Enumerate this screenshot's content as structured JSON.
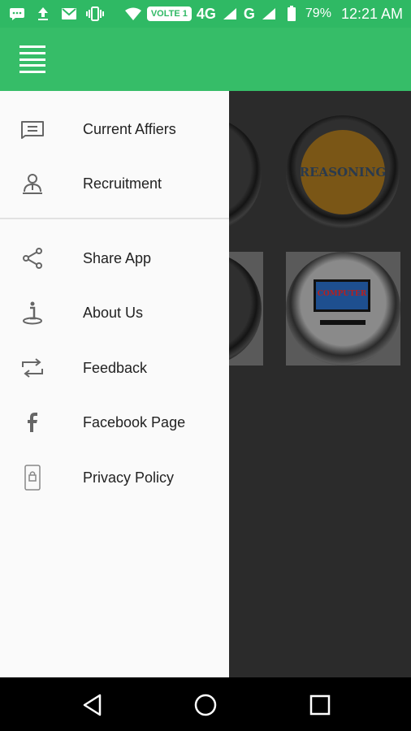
{
  "status_bar": {
    "volte_label": "VOLTE 1",
    "network_1": "4G",
    "network_2": "G",
    "battery_percent": "79%",
    "time": "12:21 AM",
    "icons": [
      "message-icon",
      "upload-icon",
      "gmail-icon",
      "vibrate-icon",
      "wifi-icon",
      "signal-icon",
      "battery-icon"
    ]
  },
  "app_bar": {
    "menu_icon": "hamburger-menu-icon"
  },
  "background_tiles": {
    "reasoning_label": "REASONING",
    "computer_label": "COMPUTER"
  },
  "drawer": {
    "primary_items": [
      {
        "label": "Current Affiers",
        "icon": "newspaper-icon"
      },
      {
        "label": "Recruitment",
        "icon": "person-icon"
      }
    ],
    "secondary_items": [
      {
        "label": "Share App",
        "icon": "share-icon"
      },
      {
        "label": "About Us",
        "icon": "info-person-icon"
      },
      {
        "label": "Feedback",
        "icon": "repeat-icon"
      },
      {
        "label": "Facebook Page",
        "icon": "facebook-icon"
      },
      {
        "label": "Privacy Policy",
        "icon": "lock-phone-icon"
      }
    ]
  },
  "nav_bar": {
    "buttons": [
      "back-icon",
      "home-icon",
      "recents-icon"
    ]
  },
  "colors": {
    "status_bar": "#2fb964",
    "app_bar": "#36bd68",
    "drawer_bg": "#fafafa",
    "scrim": "#2b2b2b"
  }
}
